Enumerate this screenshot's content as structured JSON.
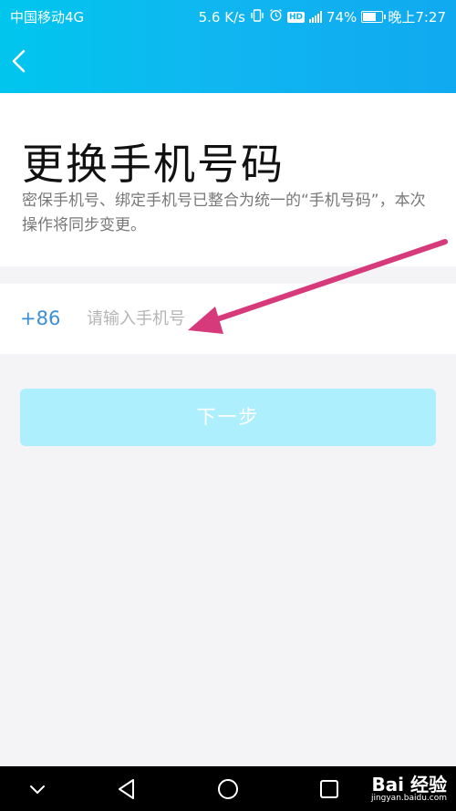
{
  "status_bar": {
    "carrier": "中国移动4G",
    "speed": "5.6 K/s",
    "hd": "HD",
    "battery": "74%",
    "time": "晚上7:27",
    "battery_level": 0.74
  },
  "page": {
    "title": "更换手机号码",
    "description": "密保手机号、绑定手机号已整合为统一的“手机号码”，本次操作将同步变更。"
  },
  "phone": {
    "country_code": "+86",
    "placeholder": "请输入手机号",
    "value": ""
  },
  "next_button": {
    "label": "下一步"
  },
  "watermark": {
    "logo": "Bai 经验",
    "url": "jingyan.baidu.com"
  },
  "colors": {
    "header_gradient_start": "#00c6ee",
    "header_gradient_end": "#10a9f0",
    "accent_blue": "#3a8fd6",
    "button_disabled_bg": "#aeeffd",
    "annotation_arrow": "#d63a7a"
  },
  "icons": {
    "back": "chevron-left-icon",
    "vibrate": "vibrate-icon",
    "alarm": "alarm-icon",
    "signal": "signal-icon",
    "battery": "battery-icon",
    "nav_collapse": "chevron-down-icon",
    "nav_back": "triangle-back-icon",
    "nav_home": "circle-home-icon",
    "nav_recents": "square-recents-icon"
  }
}
